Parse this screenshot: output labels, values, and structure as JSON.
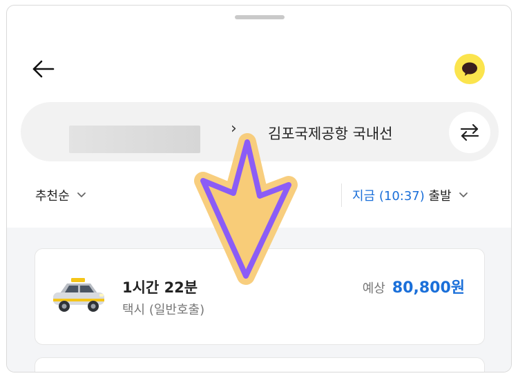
{
  "route": {
    "destination": "김포국제공항 국내선",
    "separator": "›"
  },
  "filters": {
    "sort_label": "추천순",
    "time_prefix": "지금 (10:37)",
    "time_suffix": "출발"
  },
  "result": {
    "duration": "1시간 22분",
    "mode": "택시 (일반호출)",
    "fare_label": "예상",
    "fare_value": "80,800원"
  },
  "icons": {
    "back": "arrow-left-icon",
    "kakao": "kakaotalk-icon",
    "swap": "swap-arrows-icon",
    "taxi": "taxi-icon",
    "chevron": "chevron-down-icon"
  },
  "colors": {
    "accent": "#1a6fd9",
    "kakao_yellow": "#fbe44d",
    "annotation_fill": "#f8cc78",
    "annotation_stroke": "#8b5cf6"
  }
}
